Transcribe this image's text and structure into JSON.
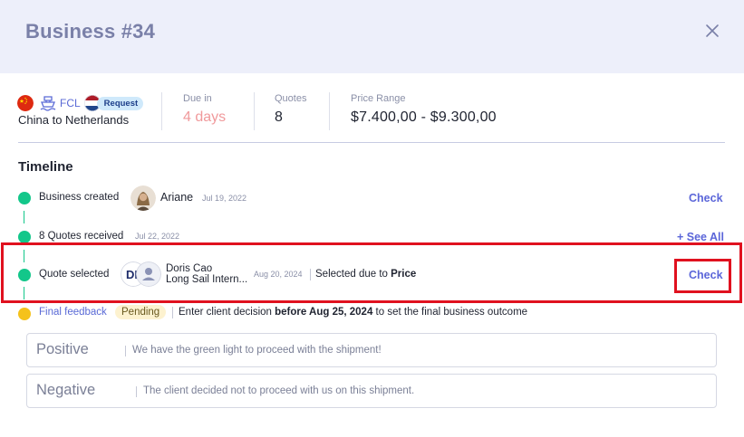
{
  "header": {
    "title": "Business #34",
    "close_icon": "close-icon"
  },
  "summary": {
    "mode": "FCL",
    "badge": "Request",
    "route": "China to Netherlands",
    "origin_flag": "china-flag-icon",
    "destination_flag": "netherlands-flag-icon",
    "due_label": "Due in",
    "due_value": "4 days",
    "quotes_label": "Quotes",
    "quotes_value": "8",
    "price_label": "Price Range",
    "price_value": "$7.400,00 - $9.300,00",
    "colors": {
      "due": "#f0999b",
      "accent": "#5b66d9"
    }
  },
  "timeline": {
    "title": "Timeline",
    "events": [
      {
        "label": "Business created",
        "user": "Ariane",
        "date": "Jul 19, 2022",
        "action": "Check"
      },
      {
        "label": "8 Quotes received",
        "date": "Jul 22, 2022",
        "action": "+ See All"
      },
      {
        "label": "Quote selected",
        "contact_name": "Doris Cao",
        "contact_company": "Long Sail Intern...",
        "date": "Aug 20, 2024",
        "reason_prefix": "Selected due to ",
        "reason": "Price",
        "action": "Check"
      },
      {
        "label": "Final feedback",
        "status": "Pending",
        "instr_pre": "Enter client decision ",
        "instr_bold": "before Aug 25, 2024",
        "instr_post": " to set the final business outcome"
      }
    ],
    "colors": {
      "done": "#13c78a",
      "pending": "#f5c21b"
    }
  },
  "options": [
    {
      "title": "Positive",
      "description": "We have the green light to proceed with the shipment!"
    },
    {
      "title": "Negative",
      "description": "The client decided not to proceed with us on this shipment."
    }
  ]
}
